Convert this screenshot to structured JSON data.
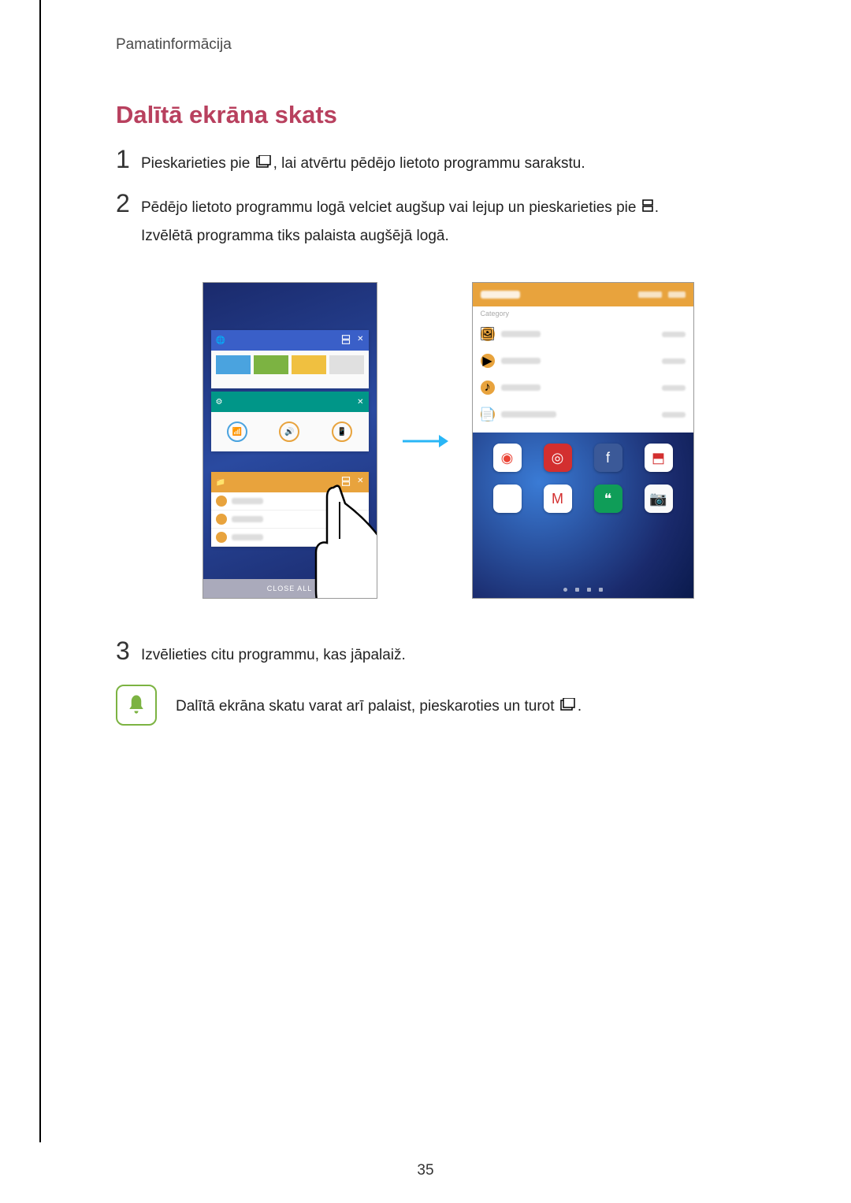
{
  "breadcrumb": "Pamatinformācija",
  "section_title": "Dalītā ekrāna skats",
  "steps": {
    "s1": {
      "num": "1",
      "prefix": "Pieskarieties pie ",
      "suffix": ", lai atvērtu pēdējo lietoto programmu sarakstu."
    },
    "s2": {
      "num": "2",
      "line1_prefix": "Pēdējo lietoto programmu logā velciet augšup vai lejup un pieskarieties pie ",
      "line1_suffix": ".",
      "line2": "Izvēlētā programma tiks palaista augšējā logā."
    },
    "s3": {
      "num": "3",
      "text": "Izvēlieties citu programmu, kas jāpalaiž."
    }
  },
  "note": {
    "prefix": "Dalītā ekrāna skatu varat arī palaist, pieskaroties un turot ",
    "suffix": "."
  },
  "figure_left": {
    "close_all": "CLOSE ALL"
  },
  "figure_right": {
    "category_label": "Category"
  },
  "icons": {
    "recent": "recent-apps-icon",
    "split": "split-window-icon",
    "bell": "bell-icon"
  },
  "page_number": "35"
}
